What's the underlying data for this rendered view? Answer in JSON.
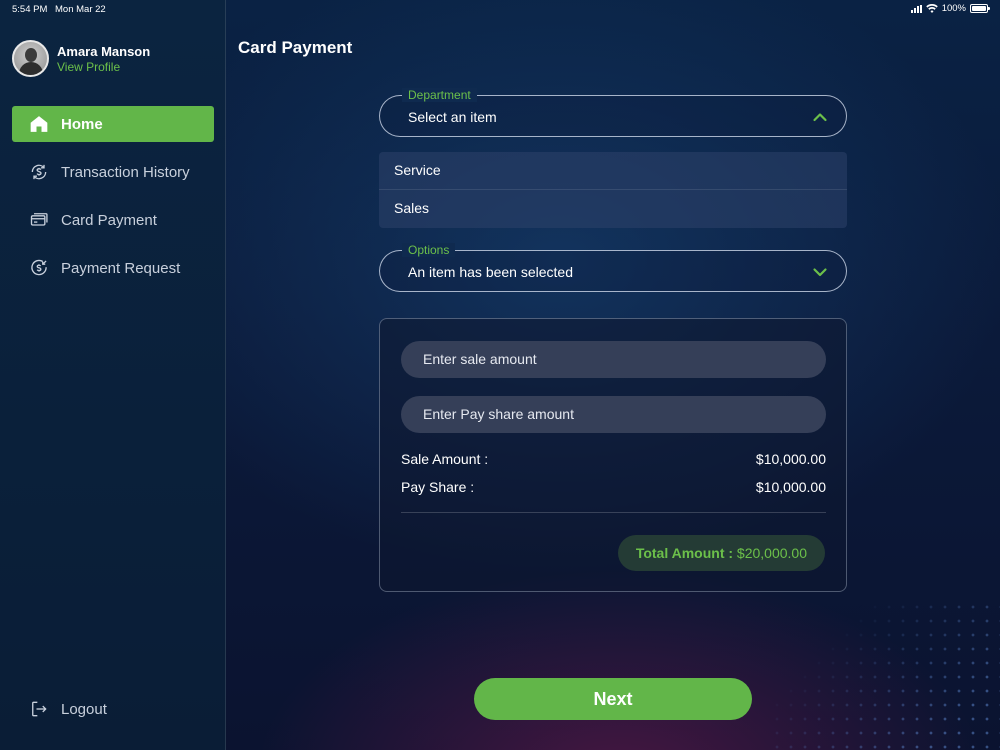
{
  "status_bar": {
    "time": "5:54 PM",
    "date": "Mon Mar 22",
    "battery": "100%",
    "icons": [
      "signal-icon",
      "wifi-icon",
      "battery-icon"
    ]
  },
  "profile": {
    "name": "Amara Manson",
    "link": "View Profile",
    "link_color": "#6cc04a"
  },
  "sidebar": {
    "items": [
      {
        "label": "Home",
        "icon": "home-icon",
        "active": true
      },
      {
        "label": "Transaction History",
        "icon": "transaction-history-icon",
        "active": false
      },
      {
        "label": "Card Payment",
        "icon": "card-icon",
        "active": false
      },
      {
        "label": "Payment Request",
        "icon": "payment-request-icon",
        "active": false
      }
    ],
    "logout": {
      "label": "Logout",
      "icon": "logout-icon"
    },
    "active_color": "#62b649"
  },
  "page": {
    "title": "Card Payment"
  },
  "department": {
    "label": "Department",
    "value": "Select an item",
    "expanded": true,
    "options": [
      "Service",
      "Sales"
    ]
  },
  "options_field": {
    "label": "Options",
    "value": "An item has been selected",
    "expanded": false
  },
  "amounts": {
    "sale_placeholder": "Enter sale amount",
    "pay_share_placeholder": "Enter Pay share amount",
    "sale_label": "Sale Amount :",
    "sale_value": "$10,000.00",
    "pay_share_label": "Pay Share :",
    "pay_share_value": "$10,000.00",
    "total_label": "Total Amount :",
    "total_value": "$20,000.00"
  },
  "actions": {
    "next_label": "Next"
  }
}
